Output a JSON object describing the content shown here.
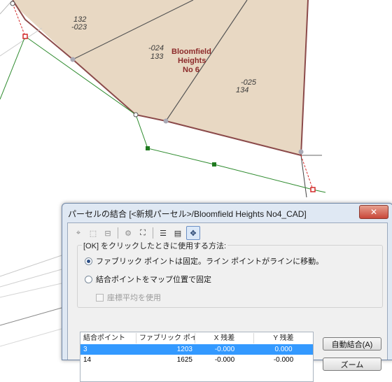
{
  "map": {
    "parcel_labels": [
      {
        "line1": "132",
        "line2": "-023"
      },
      {
        "line1": "-024",
        "line2": "133"
      },
      {
        "line1": "-025",
        "line2": "134"
      }
    ],
    "parcel_name": {
      "line1": "Bloomfield",
      "line2": "Heights",
      "line3": "No 6"
    },
    "colors": {
      "parcel_fill": "#e8d8c3",
      "parcel_border": "#8b4a4a",
      "green_line": "#2e8b2e",
      "red_marker": "#d42a2a"
    }
  },
  "dialog": {
    "title": "パーセルの結合 [<新規パーセル>/Bloomfield Heights No4_CAD]",
    "close_icon": "close-x",
    "toolbar_icons": [
      "select-point-icon",
      "select-area-icon",
      "select-remove-icon",
      "xy-icon",
      "zoom-extent-icon",
      "edit-table-icon",
      "chart-icon",
      "join-point-icon"
    ],
    "method_group": {
      "label": "[OK] をクリックしたときに使用する方法:",
      "option1": "ファブリック ポイントは固定。ライン ポイントがラインに移動。",
      "option2": "結合ポイントをマップ位置で固定",
      "checkbox": "座標平均を使用",
      "selected": "option1"
    },
    "grid": {
      "columns": [
        "結合ポイント",
        "ファブリック ポイ...",
        "X 残差",
        "Y 残差"
      ],
      "rows": [
        {
          "join_point": "3",
          "fabric_point": "1203",
          "x_residual": "-0.000",
          "y_residual": "0.000",
          "selected": true
        },
        {
          "join_point": "14",
          "fabric_point": "1625",
          "x_residual": "-0.000",
          "y_residual": "-0.000",
          "selected": false
        }
      ]
    },
    "buttons": {
      "auto_join": "自動結合(A)",
      "zoom": "ズーム"
    }
  }
}
